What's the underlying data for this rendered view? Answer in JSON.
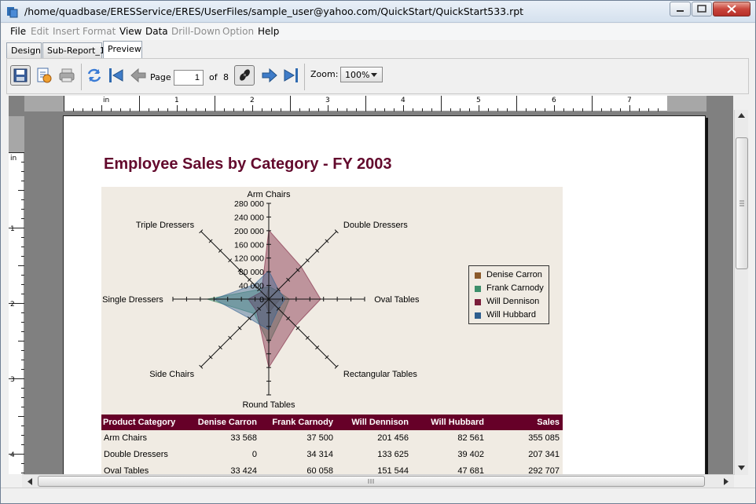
{
  "window": {
    "title": "/home/quadbase/ERESService/ERES/UserFiles/sample_user@yahoo.com/QuickStart/QuickStart533.rpt"
  },
  "menu": [
    {
      "label": "File",
      "enabled": true
    },
    {
      "label": "Edit",
      "enabled": false
    },
    {
      "label": "Insert",
      "enabled": false
    },
    {
      "label": "Format",
      "enabled": false
    },
    {
      "label": "View",
      "enabled": true
    },
    {
      "label": "Data",
      "enabled": true
    },
    {
      "label": "Drill-Down",
      "enabled": false
    },
    {
      "label": "Option",
      "enabled": false
    },
    {
      "label": "Help",
      "enabled": true
    }
  ],
  "tabs": [
    {
      "label": "Design",
      "active": false
    },
    {
      "label": "Sub-Report_1",
      "active": false
    },
    {
      "label": "Preview",
      "active": true
    }
  ],
  "toolbar": {
    "page_label": "Page",
    "page_value": "1",
    "of_label": "of",
    "total_pages": "8",
    "zoom_label": "Zoom:",
    "zoom_value": "100%",
    "icons": [
      "save-icon",
      "export-icon",
      "print-icon",
      "refresh-icon",
      "first-page-icon",
      "previous-page-icon",
      "search-icon",
      "next-page-icon",
      "last-page-icon"
    ]
  },
  "rulers": {
    "unit": "in",
    "top_ticks": [
      "1",
      "2",
      "3",
      "4",
      "5",
      "6",
      "7"
    ],
    "left_ticks": [
      "1",
      "2",
      "3",
      "4"
    ]
  },
  "report": {
    "title": "Employee Sales by Category - FY 2003",
    "title_color": "#630a2d"
  },
  "chart_data": {
    "type": "radar",
    "axes": [
      "Arm Chairs",
      "Double Dressers",
      "Oval Tables",
      "Rectangular Tables",
      "Round Tables",
      "Side Chairs",
      "Single Dressers",
      "Triple Dressers"
    ],
    "scale_labels": [
      "280 000",
      "240 000",
      "200 000",
      "160 000",
      "120 000",
      "80 000",
      "40 000",
      "0"
    ],
    "range": [
      0,
      280000
    ],
    "series": [
      {
        "name": "Denise Carron",
        "color": "#8b5a2b",
        "values": [
          33568,
          0,
          33424,
          25000,
          40000,
          15000,
          20000,
          10000
        ]
      },
      {
        "name": "Frank Carnody",
        "color": "#3d8f6b",
        "values": [
          37500,
          34314,
          60058,
          60000,
          130000,
          60000,
          180000,
          40000
        ]
      },
      {
        "name": "Will Dennison",
        "color": "#7a1d3a",
        "values": [
          201456,
          133625,
          151544,
          110000,
          200000,
          50000,
          60000,
          30000
        ]
      },
      {
        "name": "Will Hubbard",
        "color": "#2f5f8f",
        "values": [
          82561,
          39402,
          47681,
          40000,
          90000,
          80000,
          160000,
          60000
        ]
      }
    ],
    "legend_position": "right",
    "grid": false
  },
  "table": {
    "header_color": "#660028",
    "columns": [
      "Product Category",
      "Denise Carron",
      "Frank Carnody",
      "Will Dennison",
      "Will Hubbard",
      "Sales"
    ],
    "rows": [
      [
        "Arm Chairs",
        "33 568",
        "37 500",
        "201 456",
        "82 561",
        "355 085"
      ],
      [
        "Double Dressers",
        "0",
        "34 314",
        "133 625",
        "39 402",
        "207 341"
      ],
      [
        "Oval Tables",
        "33 424",
        "60 058",
        "151 544",
        "47 681",
        "292 707"
      ]
    ]
  }
}
